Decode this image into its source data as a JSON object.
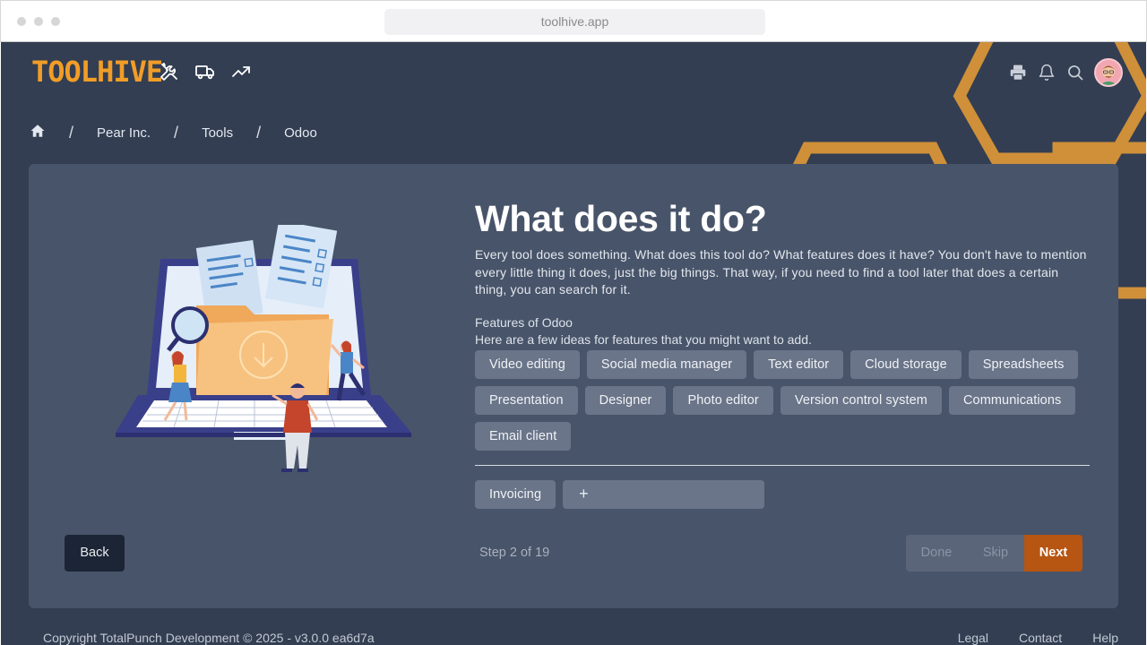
{
  "browser": {
    "url": "toolhive.app"
  },
  "header": {
    "logo": "TOOLHIVE",
    "nav_icons": [
      "tools-icon",
      "truck-icon",
      "trending-up-icon"
    ],
    "right_icons": [
      "printer-icon",
      "bell-icon",
      "search-icon",
      "avatar"
    ]
  },
  "breadcrumb": {
    "items": [
      "Pear Inc.",
      "Tools",
      "Odoo"
    ],
    "separator": "/"
  },
  "main": {
    "title": "What does it do?",
    "description": "Every tool does something. What does this tool do? What features does it have? You don't have to mention every little thing it does, just the big things. That way, if you need to find a tool later that does a certain thing, you can search for it.",
    "features_title": "Features of Odoo",
    "features_hint": "Here are a few ideas for features that you might want to add.",
    "suggestions": [
      "Video editing",
      "Social media manager",
      "Text editor",
      "Cloud storage",
      "Spreadsheets",
      "Presentation",
      "Designer",
      "Photo editor",
      "Version control system",
      "Communications",
      "Email client"
    ],
    "selected": [
      "Invoicing"
    ],
    "add_symbol": "+"
  },
  "actions": {
    "back": "Back",
    "step": "Step 2 of 19",
    "done": "Done",
    "skip": "Skip",
    "next": "Next"
  },
  "footer": {
    "copyright": "Copyright TotalPunch Development © 2025 - v3.0.0 ea6d7a",
    "links": [
      "Legal",
      "Contact",
      "Help"
    ]
  },
  "colors": {
    "brand": "#f29d27",
    "background": "#333e52",
    "card": "#485469",
    "chip": "#6a7589",
    "next": "#b75512",
    "back": "#1c2535"
  }
}
